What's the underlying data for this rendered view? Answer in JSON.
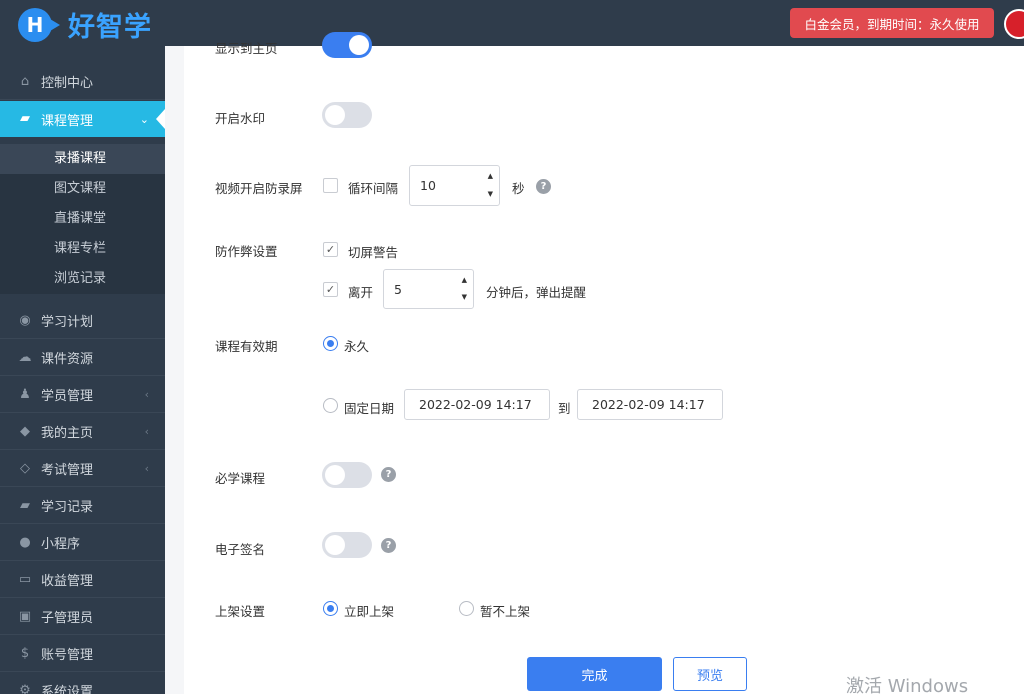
{
  "header": {
    "logo_letter": "H",
    "logo_text": "好智学",
    "member_badge": "白金会员，到期时间：永久使用"
  },
  "sidebar": {
    "items": [
      {
        "label": "控制中心",
        "icon": "home-icon"
      },
      {
        "label": "课程管理",
        "icon": "book-icon",
        "active": true
      },
      {
        "label": "学习计划",
        "icon": "eye-icon"
      },
      {
        "label": "课件资源",
        "icon": "cloud-icon"
      },
      {
        "label": "学员管理",
        "icon": "users-icon"
      },
      {
        "label": "我的主页",
        "icon": "graduation-cap-icon"
      },
      {
        "label": "考试管理",
        "icon": "tag-icon"
      },
      {
        "label": "学习记录",
        "icon": "book-icon"
      },
      {
        "label": "小程序",
        "icon": "wechat-icon"
      },
      {
        "label": "收益管理",
        "icon": "credit-card-icon"
      },
      {
        "label": "子管理员",
        "icon": "lock-icon"
      },
      {
        "label": "账号管理",
        "icon": "dollar-icon"
      },
      {
        "label": "系统设置",
        "icon": "gear-icon"
      }
    ],
    "sub_items": [
      "录播课程",
      "图文课程",
      "直播课堂",
      "课程专栏",
      "浏览记录"
    ]
  },
  "form": {
    "show_home_label": "显示到主页",
    "watermark_label": "开启水印",
    "anti_record_label": "视频开启防录屏",
    "loop_interval_label": "循环间隔",
    "loop_interval_value": "10",
    "seconds_unit": "秒",
    "anti_cheat_label": "防作弊设置",
    "switch_warning_label": "切屏警告",
    "leave_label": "离开",
    "leave_value": "5",
    "leave_suffix": "分钟后，弹出提醒",
    "validity_label": "课程有效期",
    "forever_label": "永久",
    "fixed_date_label": "固定日期",
    "date_start": "2022-02-09 14:17",
    "to_label": "到",
    "date_end": "2022-02-09 14:17",
    "required_label": "必学课程",
    "esign_label": "电子签名",
    "shelf_label": "上架设置",
    "shelf_now_label": "立即上架",
    "shelf_later_label": "暂不上架"
  },
  "buttons": {
    "done": "完成",
    "preview": "预览"
  },
  "os_watermark": "激活 Windows"
}
